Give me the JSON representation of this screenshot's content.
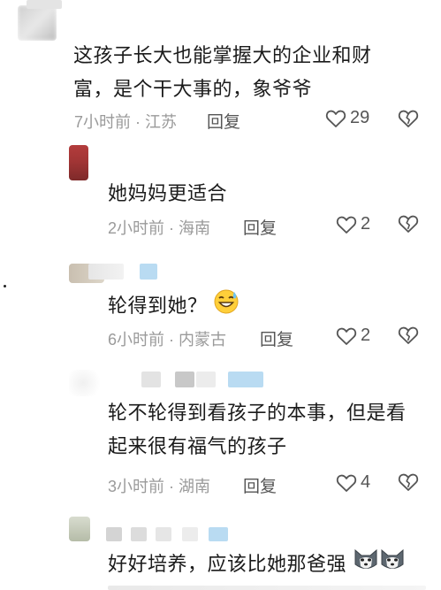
{
  "comments": [
    {
      "text_lines": [
        "这孩子长大也能掌握大的企业和财",
        "富，是个干大事的，象爷爷"
      ],
      "time": "7小时前",
      "location": "江苏",
      "reply_label": "回复",
      "likes": "29"
    },
    {
      "text_lines": [
        "她妈妈更适合"
      ],
      "time": "2小时前",
      "location": "海南",
      "reply_label": "回复",
      "likes": "2"
    },
    {
      "text_lines": [
        "轮得到她？"
      ],
      "time": "6小时前",
      "location": "内蒙古",
      "reply_label": "回复",
      "likes": "2"
    },
    {
      "text_lines": [
        "轮不轮得到看孩子的本事，但是看",
        "起来很有福气的孩子"
      ],
      "time": "3小时前",
      "location": "湖南",
      "reply_label": "回复",
      "likes": "4"
    },
    {
      "text_lines": [
        "好好培养，应该比她那爸强"
      ],
      "time": "",
      "location": "",
      "reply_label": "",
      "likes": ""
    }
  ],
  "meta_separator": " · ",
  "icons": {
    "like": "heart-outline-icon",
    "dislike": "broken-heart-icon",
    "emoji_sweat": "grinning-sweat-emoji",
    "emoji_husky": "husky-dog-emoji"
  },
  "colors": {
    "meta_gray": "#9a9a9a",
    "text": "#1b1b1b",
    "avatar_red": "#a8393a"
  }
}
